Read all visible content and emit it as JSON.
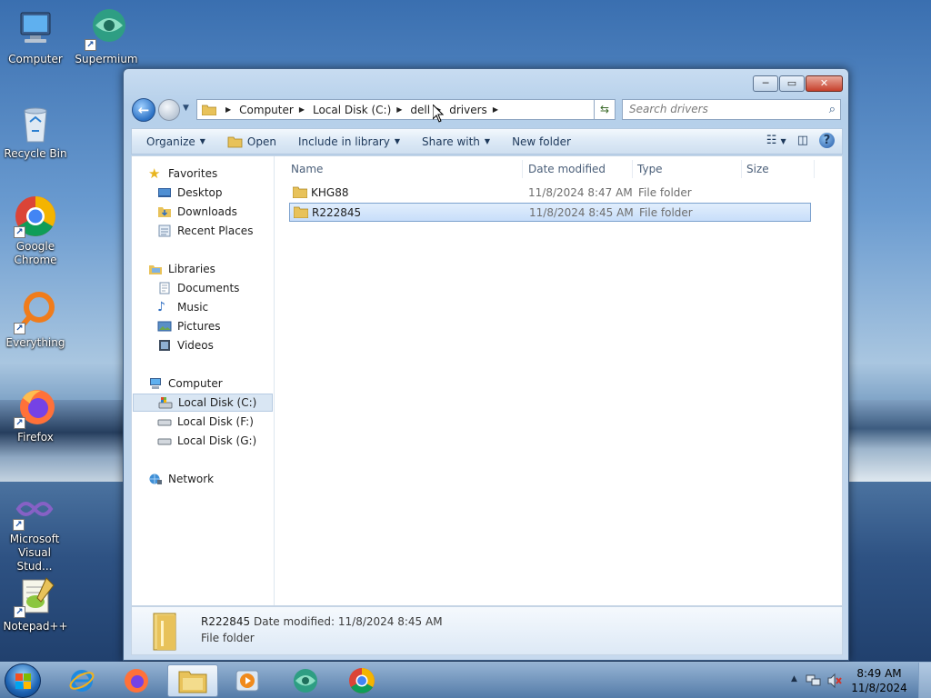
{
  "desktop": {
    "icons": [
      {
        "label": "Computer",
        "icon": "computer-icon"
      },
      {
        "label": "Supermium",
        "icon": "supermium-icon"
      },
      {
        "label": "Recycle Bin",
        "icon": "recycle-bin-icon"
      },
      {
        "label": "Google Chrome",
        "icon": "chrome-icon"
      },
      {
        "label": "Everything",
        "icon": "everything-icon"
      },
      {
        "label": "Firefox",
        "icon": "firefox-icon"
      },
      {
        "label": "Microsoft Visual Stud...",
        "icon": "visual-studio-icon"
      },
      {
        "label": "Notepad++",
        "icon": "notepadpp-icon"
      }
    ]
  },
  "window": {
    "controls": {
      "minimize": "─",
      "maximize": "▭",
      "close": "✕"
    },
    "breadcrumb": [
      "Computer",
      "Local Disk (C:)",
      "dell",
      "drivers"
    ],
    "search_placeholder": "Search drivers",
    "toolbar": {
      "organize": "Organize",
      "open": "Open",
      "include_in_library": "Include in library",
      "share_with": "Share with",
      "new_folder": "New folder"
    },
    "nav": {
      "favorites": "Favorites",
      "desktop": "Desktop",
      "downloads": "Downloads",
      "recent_places": "Recent Places",
      "libraries": "Libraries",
      "documents": "Documents",
      "music": "Music",
      "pictures": "Pictures",
      "videos": "Videos",
      "computer": "Computer",
      "local_disk_c": "Local Disk (C:)",
      "local_disk_f": "Local Disk (F:)",
      "local_disk_g": "Local Disk (G:)",
      "network": "Network"
    },
    "columns": {
      "name": "Name",
      "date_modified": "Date modified",
      "type": "Type",
      "size": "Size"
    },
    "files": [
      {
        "name": "KHG88",
        "date": "11/8/2024 8:47 AM",
        "type": "File folder",
        "selected": false
      },
      {
        "name": "R222845",
        "date": "11/8/2024 8:45 AM",
        "type": "File folder",
        "selected": true
      }
    ],
    "details": {
      "name": "R222845",
      "modified": "Date modified: 11/8/2024 8:45 AM",
      "type": "File folder"
    }
  },
  "taskbar": {
    "apps": [
      "internet-explorer-icon",
      "firefox-icon",
      "file-explorer-icon",
      "media-player-icon",
      "supermium-icon",
      "chrome-icon"
    ],
    "clock_time": "8:49 AM",
    "clock_date": "11/8/2024"
  },
  "colors": {
    "accent": "#2c72c5",
    "selection": "#c8defa",
    "folder": "#e8c25a"
  }
}
